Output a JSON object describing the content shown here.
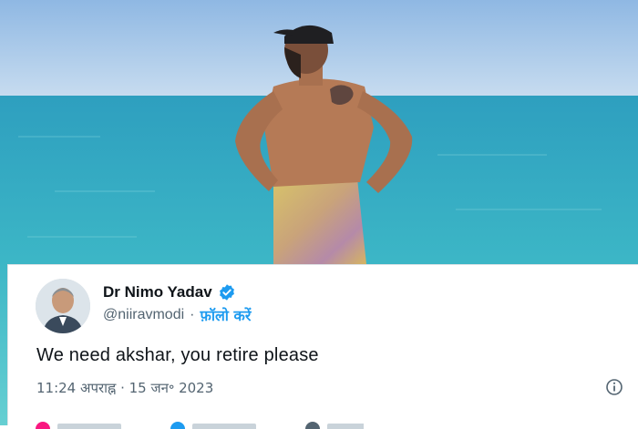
{
  "photo": {
    "sky_color": "#9fc3e6",
    "sea_color": "#3fb3c0"
  },
  "tweet": {
    "display_name": "Dr Nimo Yadav",
    "handle": "@niiravmodi",
    "follow_label": "फ़ॉलो करें",
    "text": "We need akshar, you retire please",
    "timestamp": "11:24 अपराह्न · 15 जन॰ 2023",
    "verified_color": "#1d9bf0",
    "like_color": "#f91880",
    "reply_color": "#1d9bf0"
  },
  "icons": {
    "verified": "verified-badge-icon",
    "info": "info-icon",
    "like": "heart-icon",
    "reply": "reply-icon",
    "share": "share-icon"
  }
}
